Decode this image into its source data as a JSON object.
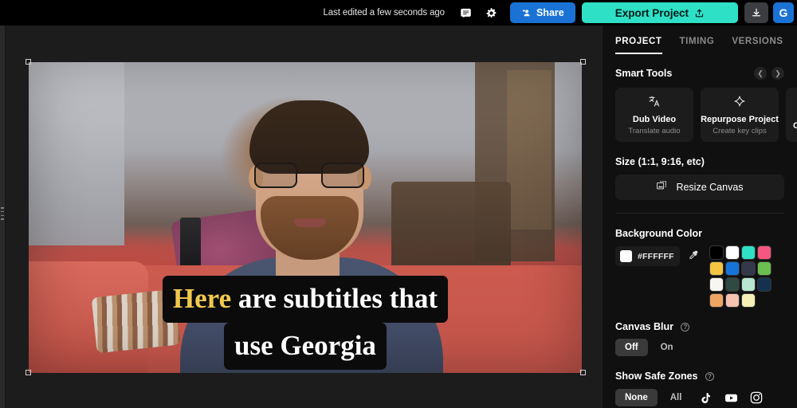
{
  "topbar": {
    "last_edited": "Last edited a few seconds ago",
    "comment_icon": "comment-icon",
    "settings_icon": "gear-icon",
    "share_label": "Share",
    "export_label": "Export Project",
    "download_icon": "download-icon",
    "avatar_initial": "G",
    "share_color": "#1a73d4",
    "export_color": "#2ee0c6"
  },
  "panel": {
    "tabs": [
      {
        "label": "PROJECT",
        "active": true
      },
      {
        "label": "TIMING",
        "active": false
      },
      {
        "label": "VERSIONS",
        "active": false
      }
    ],
    "smart_tools": {
      "title": "Smart Tools",
      "prev_icon": "chevron-left-icon",
      "next_icon": "chevron-right-icon",
      "cards": [
        {
          "title": "Dub Video",
          "subtitle": "Translate audio",
          "icon": "translate-icon"
        },
        {
          "title": "Repurpose Project",
          "subtitle": "Create key clips",
          "icon": "sparkle-icon"
        },
        {
          "title": "O",
          "subtitle": "",
          "icon": "partial-icon"
        }
      ]
    },
    "size": {
      "label": "Size (1:1, 9:16, etc)",
      "resize_label": "Resize Canvas",
      "resize_icon": "resize-canvas-icon"
    },
    "background_color": {
      "label": "Background Color",
      "hex_value": "#FFFFFF",
      "chip_color": "#FFFFFF",
      "eyedropper_icon": "eyedropper-icon",
      "swatches": [
        "#000000",
        "#FFFFFF",
        "#2EE0C6",
        "#F4577F",
        "#F5C542",
        "#1673D8",
        "#333949",
        "#6BBF4F",
        "#F8F6F0",
        "#2E4A43",
        "#B9E6D2",
        "#14324F",
        "#EFA464",
        "#F6C2B2",
        "#F5F0B8"
      ]
    },
    "canvas_blur": {
      "label": "Canvas Blur",
      "help_icon": "help-icon",
      "options": [
        {
          "label": "Off",
          "active": true
        },
        {
          "label": "On",
          "active": false
        }
      ]
    },
    "safe_zones": {
      "label": "Show Safe Zones",
      "help_icon": "help-icon",
      "options": [
        {
          "label": "None",
          "active": true
        },
        {
          "label": "All",
          "active": false
        }
      ],
      "platforms": [
        "tiktok-icon",
        "youtube-icon",
        "instagram-icon"
      ]
    }
  },
  "canvas": {
    "subtitle_line1_highlight": "Here",
    "subtitle_line1_rest": " are subtitles that",
    "subtitle_line2": "use Georgia",
    "highlight_color": "#F2C94C"
  }
}
